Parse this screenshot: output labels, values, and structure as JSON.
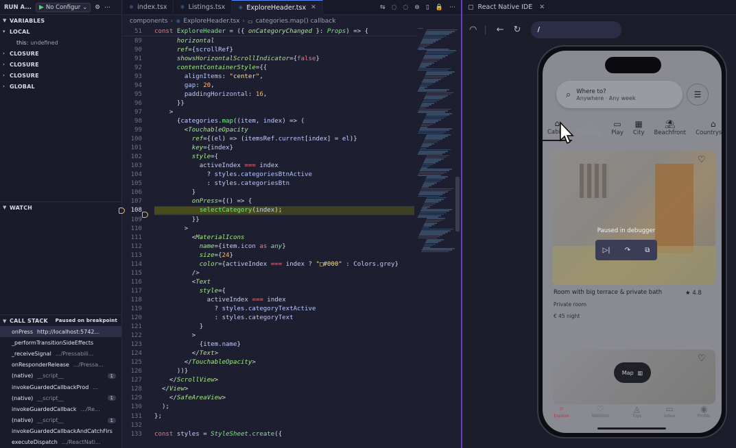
{
  "debug_toolbar": {
    "run_label": "RUN A...",
    "config": "No Configur"
  },
  "variables": {
    "title": "VARIABLES",
    "local": "LOCAL",
    "this_key": "this:",
    "this_value": "undefined",
    "closures": [
      "CLOSURE",
      "CLOSURE",
      "CLOSURE"
    ],
    "global": "GLOBAL"
  },
  "watch": {
    "title": "WATCH"
  },
  "callstack": {
    "title": "CALL STACK",
    "status": "Paused on breakpoint",
    "frames": [
      {
        "fn": "onPress",
        "src": "http://localhost:5742...",
        "badge": ""
      },
      {
        "fn": "_performTransitionSideEffects",
        "src": "",
        "badge": ""
      },
      {
        "fn": "_receiveSignal",
        "src": ".../Pressabili...",
        "badge": ""
      },
      {
        "fn": "onResponderRelease",
        "src": ".../Pressa...",
        "badge": ""
      },
      {
        "fn": "(native)",
        "src": "__script__",
        "badge": "1"
      },
      {
        "fn": "invokeGuardedCallbackProd",
        "src": "...",
        "badge": ""
      },
      {
        "fn": "(native)",
        "src": "__script__",
        "badge": "1"
      },
      {
        "fn": "invokeGuardedCallback",
        "src": ".../Re...",
        "badge": ""
      },
      {
        "fn": "(native)",
        "src": "__script__",
        "badge": "1"
      },
      {
        "fn": "invokeGuardedCallbackAndCatchFirs",
        "src": "",
        "badge": ""
      },
      {
        "fn": "executeDispatch",
        "src": ".../ReactNati...",
        "badge": ""
      }
    ]
  },
  "editor": {
    "tabs": [
      {
        "label": "index.tsx",
        "active": false
      },
      {
        "label": "Listings.tsx",
        "active": false
      },
      {
        "label": "ExploreHeader.tsx",
        "active": true
      }
    ],
    "breadcrumb": [
      "components",
      "ExploreHeader.tsx",
      "categories.map() callback"
    ],
    "sticky": {
      "num": "51",
      "html": "<span class=\"kw\">const</span> <span class=\"fnc\">ExploreHeader</span> = ({ <span class=\"attr\">onCategoryChanged</span> }: <span class=\"cls\">Props</span>) => {"
    },
    "current_line": "108",
    "lines": [
      {
        "n": "89",
        "html": "      <span class=\"attr\">horizontal</span>"
      },
      {
        "n": "90",
        "html": "      <span class=\"attr\">ref</span>={<span class=\"var\">scrollRef</span>}"
      },
      {
        "n": "91",
        "html": "      <span class=\"attr\">showsHorizontalScrollIndicator</span>={<span class=\"kw\">false</span>}"
      },
      {
        "n": "92",
        "html": "      <span class=\"attr\">contentContainerStyle</span>={{"
      },
      {
        "n": "93",
        "html": "        <span class=\"prop\">alignItems</span>: <span class=\"str\">\"center\"</span>,"
      },
      {
        "n": "94",
        "html": "        <span class=\"prop\">gap</span>: <span class=\"num\">20</span>,"
      },
      {
        "n": "95",
        "html": "        <span class=\"prop\">paddingHorizontal</span>: <span class=\"num\">16</span>,"
      },
      {
        "n": "96",
        "html": "      }}"
      },
      {
        "n": "97",
        "html": "    >"
      },
      {
        "n": "98",
        "html": "      {<span class=\"var\">categories</span>.<span class=\"fnc\">map</span>((<span class=\"var\">item</span>, <span class=\"var\">index</span>) => ("
      },
      {
        "n": "99",
        "html": "        &lt;<span class=\"jsx\">TouchableOpacity</span>"
      },
      {
        "n": "100",
        "html": "          <span class=\"attr\">ref</span>={(<span class=\"var\">el</span>) => (<span class=\"var\">itemsRef</span>.<span class=\"prop\">current</span>[<span class=\"var\">index</span>] = <span class=\"var\">el</span>)}"
      },
      {
        "n": "101",
        "html": "          <span class=\"attr\">key</span>={<span class=\"var\">index</span>}"
      },
      {
        "n": "102",
        "html": "          <span class=\"attr\">style</span>={"
      },
      {
        "n": "103",
        "html": "            <span class=\"var\">activeIndex</span> <span class=\"kw\">===</span> <span class=\"var\">index</span>"
      },
      {
        "n": "104",
        "html": "              ? <span class=\"var\">styles</span>.<span class=\"prop\">categoriesBtnActive</span>"
      },
      {
        "n": "105",
        "html": "              : <span class=\"var\">styles</span>.<span class=\"prop\">categoriesBtn</span>"
      },
      {
        "n": "106",
        "html": "          }"
      },
      {
        "n": "107",
        "html": "          <span class=\"attr\">onPress</span>={() => {"
      },
      {
        "n": "108",
        "html": "            <span class=\"fnc\">selectCategory</span>(<span class=\"var\">index</span>);",
        "hl": true
      },
      {
        "n": "109",
        "html": "          }}"
      },
      {
        "n": "110",
        "html": "        >"
      },
      {
        "n": "111",
        "html": "          &lt;<span class=\"jsx\">MaterialIcons</span>"
      },
      {
        "n": "112",
        "html": "            <span class=\"attr\">name</span>={<span class=\"var\">item</span>.<span class=\"prop\">icon</span> <span class=\"kw\">as</span> <span class=\"cls\">any</span>}"
      },
      {
        "n": "113",
        "html": "            <span class=\"attr\">size</span>={<span class=\"num\">24</span>}"
      },
      {
        "n": "114",
        "html": "            <span class=\"attr\">color</span>={<span class=\"var\">activeIndex</span> <span class=\"kw\">===</span> <span class=\"var\">index</span> ? <span class=\"str\">\"&#9633;#000\"</span> : <span class=\"var\">Colors</span>.<span class=\"prop\">grey</span>}"
      },
      {
        "n": "115",
        "html": "          />"
      },
      {
        "n": "116",
        "html": "          &lt;<span class=\"jsx\">Text</span>"
      },
      {
        "n": "117",
        "html": "            <span class=\"attr\">style</span>={"
      },
      {
        "n": "118",
        "html": "              <span class=\"var\">activeIndex</span> <span class=\"kw\">===</span> <span class=\"var\">index</span>"
      },
      {
        "n": "119",
        "html": "                ? <span class=\"var\">styles</span>.<span class=\"prop\">categoryTextActive</span>"
      },
      {
        "n": "120",
        "html": "                : <span class=\"var\">styles</span>.<span class=\"prop\">categoryText</span>"
      },
      {
        "n": "121",
        "html": "            }"
      },
      {
        "n": "122",
        "html": "          >"
      },
      {
        "n": "123",
        "html": "            {<span class=\"var\">item</span>.<span class=\"prop\">name</span>}"
      },
      {
        "n": "124",
        "html": "          &lt;/<span class=\"jsx\">Text</span>>"
      },
      {
        "n": "125",
        "html": "        &lt;/<span class=\"jsx\">TouchableOpacity</span>>"
      },
      {
        "n": "126",
        "html": "      ))}"
      },
      {
        "n": "127",
        "html": "    &lt;/<span class=\"jsx\">ScrollView</span>>"
      },
      {
        "n": "128",
        "html": "  &lt;/<span class=\"jsx\">View</span>>"
      },
      {
        "n": "129",
        "html": "    &lt;/<span class=\"jsx\">SafeAreaView</span>>"
      },
      {
        "n": "130",
        "html": "  );"
      },
      {
        "n": "131",
        "html": "};"
      },
      {
        "n": "132",
        "html": ""
      },
      {
        "n": "133",
        "html": "<span class=\"kw\">const</span> <span class=\"var\">styles</span> = <span class=\"cls\">StyleSheet</span>.<span class=\"fnc\">create</span>({"
      }
    ]
  },
  "rn_ide": {
    "tab_label": "React Native IDE",
    "url": "/",
    "search_title": "Where to?",
    "search_sub": "Anywhere · Any week",
    "categories": [
      {
        "label": "Cabins",
        "active": true,
        "faded": false
      },
      {
        "label": "Trending",
        "active": false,
        "faded": true
      },
      {
        "label": "Play",
        "active": false,
        "faded": false
      },
      {
        "label": "City",
        "active": false,
        "faded": false
      },
      {
        "label": "Beachfront",
        "active": false,
        "faded": false
      },
      {
        "label": "Countryside",
        "active": false,
        "faded": false
      }
    ],
    "debugger_label": "Paused in debugger",
    "listing_title": "Room with big terrace & private bath",
    "rating": "4.8",
    "room_type": "Private room",
    "price": "€ 45 night",
    "map_label": "Map",
    "nav": [
      "Explore",
      "Wishlists",
      "Trips",
      "Inbox",
      "Profile"
    ]
  }
}
